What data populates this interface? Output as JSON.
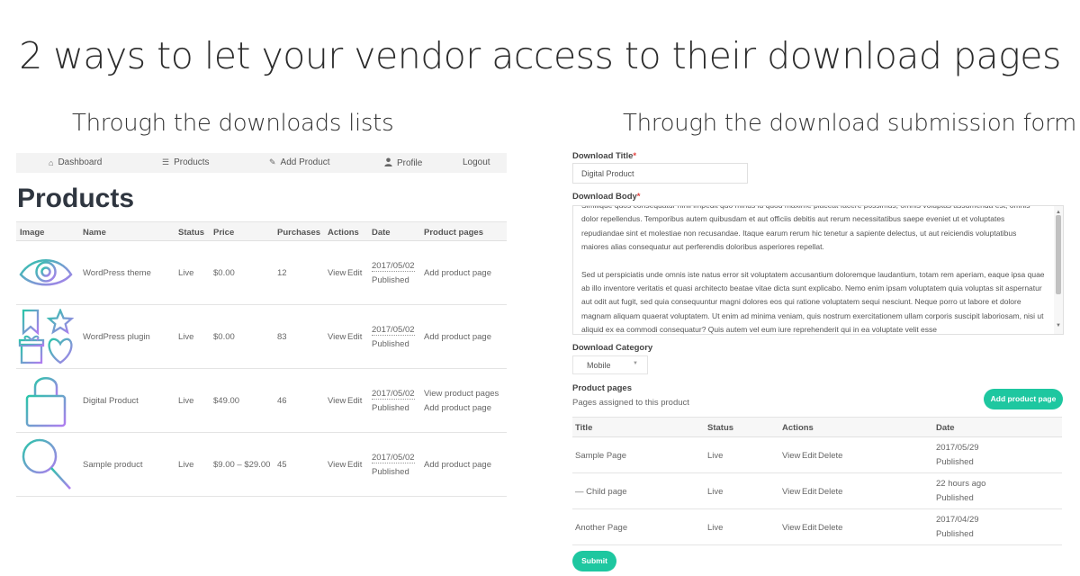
{
  "headline": "2 ways to let your vendor access to their download pages",
  "left_section": {
    "subtitle": "Through the downloads lists",
    "nav": [
      {
        "label": "Dashboard",
        "icon": "home-icon"
      },
      {
        "label": "Products",
        "icon": "list-icon"
      },
      {
        "label": "Add Product",
        "icon": "pencil-icon"
      },
      {
        "label": "Profile",
        "icon": "user-icon"
      },
      {
        "label": "Logout",
        "icon": ""
      }
    ],
    "page_title": "Products",
    "table": {
      "headers": [
        "Image",
        "Name",
        "Status",
        "Price",
        "Purchases",
        "Actions",
        "Date",
        "Product pages"
      ],
      "rows": [
        {
          "image": "eye-icon",
          "name": "WordPress theme",
          "status": "Live",
          "price": "$0.00",
          "purchases": "12",
          "view": "View",
          "edit": "Edit",
          "date": "2017/05/02",
          "date_status": "Published",
          "pages": [
            "Add product page"
          ]
        },
        {
          "image": "bookmark-star-gift-heart-icon",
          "name": "WordPress plugin",
          "status": "Live",
          "price": "$0.00",
          "purchases": "83",
          "view": "View",
          "edit": "Edit",
          "date": "2017/05/02",
          "date_status": "Published",
          "pages": [
            "Add product page"
          ]
        },
        {
          "image": "lock-icon",
          "name": "Digital Product",
          "status": "Live",
          "price": "$49.00",
          "purchases": "46",
          "view": "View",
          "edit": "Edit",
          "date": "2017/05/02",
          "date_status": "Published",
          "pages": [
            "View product pages",
            "Add product page"
          ]
        },
        {
          "image": "magnifier-icon",
          "name": "Sample product",
          "status": "Live",
          "price": "$9.00 – $29.00",
          "purchases": "45",
          "view": "View",
          "edit": "Edit",
          "date": "2017/05/02",
          "date_status": "Published",
          "pages": [
            "Add product page"
          ]
        }
      ]
    }
  },
  "right_section": {
    "subtitle": "Through the download submission form",
    "title_label": "Download Title",
    "required_mark": "*",
    "title_value": "Digital Product",
    "body_label": "Download Body",
    "body_paragraphs": [
      "Similique quos consequatur nihil impedit quo minus id quod maxime placeat facere possimus, omnis voluptas assumenda est, omnis dolor repellendus. Temporibus autem quibusdam et aut officiis debitis aut rerum necessitatibus saepe eveniet ut et voluptates repudiandae sint et molestiae non recusandae. Itaque earum rerum hic tenetur a sapiente delectus, ut aut reiciendis voluptatibus maiores alias consequatur aut perferendis doloribus asperiores repellat.",
      "Sed ut perspiciatis unde omnis iste natus error sit voluptatem accusantium doloremque laudantium, totam rem aperiam, eaque ipsa quae ab illo inventore veritatis et quasi architecto beatae vitae dicta sunt explicabo. Nemo enim ipsam voluptatem quia voluptas sit aspernatur aut odit aut fugit, sed quia consequuntur magni dolores eos qui ratione voluptatem sequi nesciunt. Neque porro ut labore et dolore magnam aliquam quaerat voluptatem. Ut enim ad minima veniam, quis nostrum exercitationem ullam corporis suscipit laboriosam, nisi ut aliquid ex ea commodi consequatur? Quis autem vel eum iure reprehenderit qui in ea voluptate velit esse"
    ],
    "category_label": "Download Category",
    "category_value": "Mobile",
    "pages_label": "Product pages",
    "pages_note": "Pages assigned to this product",
    "add_page_button": "Add product page",
    "table": {
      "headers": [
        "Title",
        "Status",
        "Actions",
        "Date"
      ],
      "rows": [
        {
          "title": "Sample Page",
          "status": "Live",
          "view": "View",
          "edit": "Edit",
          "delete": "Delete",
          "date": "2017/05/29",
          "date_status": "Published"
        },
        {
          "title": "— Child page",
          "status": "Live",
          "view": "View",
          "edit": "Edit",
          "delete": "Delete",
          "date": "22 hours ago",
          "date_status": "Published"
        },
        {
          "title": "Another Page",
          "status": "Live",
          "view": "View",
          "edit": "Edit",
          "delete": "Delete",
          "date": "2017/04/29",
          "date_status": "Published"
        }
      ]
    },
    "submit_button": "Submit"
  },
  "colors": {
    "accent": "#1ec7a0",
    "required": "#e2413e",
    "heading": "#2f3640"
  }
}
